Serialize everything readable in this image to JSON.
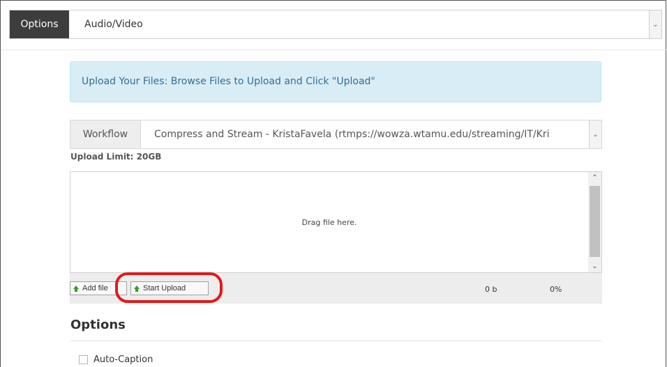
{
  "topbar": {
    "options_tab": "Options",
    "selected_value": "Audio/Video"
  },
  "alert": {
    "text": "Upload Your Files: Browse Files to Upload and Click \"Upload\""
  },
  "workflow": {
    "label": "Workflow",
    "value": "Compress and Stream - KristaFavela (rtmps://wowza.wtamu.edu/streaming/IT/Kri"
  },
  "upload_limit": "Upload Limit: 20GB",
  "dropzone": {
    "text": "Drag file here."
  },
  "toolbar": {
    "add_file_label": "Add file",
    "start_upload_label": "Start Upload",
    "size": "0 b",
    "percent": "0%"
  },
  "options_section": {
    "heading": "Options",
    "auto_caption_label": "Auto-Caption"
  },
  "colors": {
    "highlight_ring": "#e11919",
    "alert_bg": "#d9edf7",
    "options_tab_bg": "#3d3d3d"
  },
  "icons": [
    "chevron-down-icon",
    "arrow-up-icon",
    "scroll-up-arrow-icon",
    "scroll-down-arrow-icon"
  ]
}
